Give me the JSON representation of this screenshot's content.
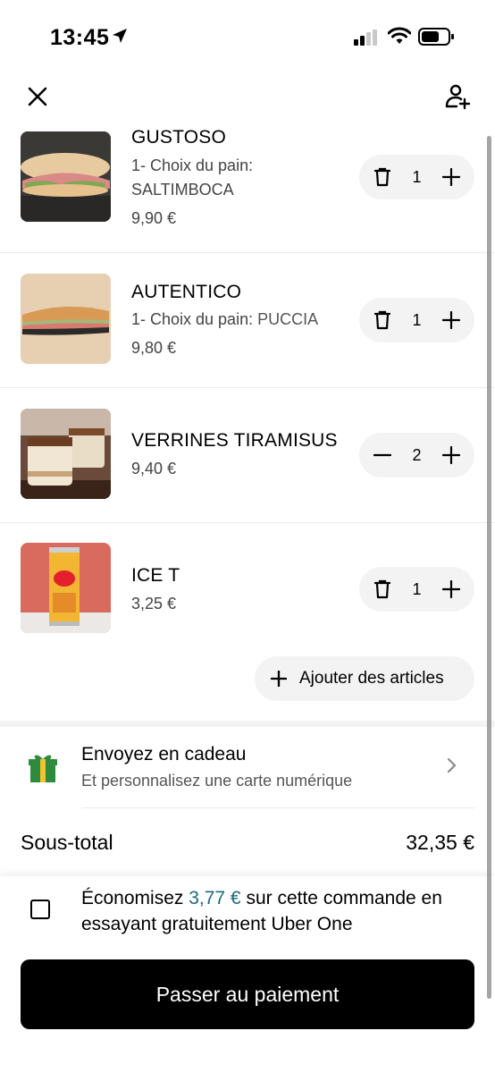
{
  "status_bar": {
    "time": "13:45"
  },
  "cart": {
    "items": [
      {
        "name": "GUSTOSO",
        "option_label": "1- Choix du pain:",
        "option_value": "SALTIMBOCA",
        "price": "9,90 €",
        "quantity": "1",
        "left_control": "trash-icon"
      },
      {
        "name": "AUTENTICO",
        "option_label": "1- Choix du pain:",
        "option_value": "PUCCIA",
        "price": "9,80 €",
        "quantity": "1",
        "left_control": "trash-icon"
      },
      {
        "name": "VERRINES TIRAMISUS",
        "price": "9,40 €",
        "quantity": "2",
        "left_control": "minus-icon"
      },
      {
        "name": "ICE T",
        "price": "3,25 €",
        "quantity": "1",
        "left_control": "trash-icon"
      }
    ],
    "add_articles_label": "Ajouter des articles"
  },
  "gift": {
    "title": "Envoyez en cadeau",
    "subtitle": "Et personnalisez une carte numérique"
  },
  "subtotal": {
    "label": "Sous-total",
    "value": "32,35 €"
  },
  "promo": {
    "prefix": "Économisez ",
    "amount": "3,77 €",
    "suffix": " sur cette commande en essayant gratuitement Uber One",
    "amount_color": "#1c6b79"
  },
  "checkout": {
    "label": "Passer au paiement"
  }
}
